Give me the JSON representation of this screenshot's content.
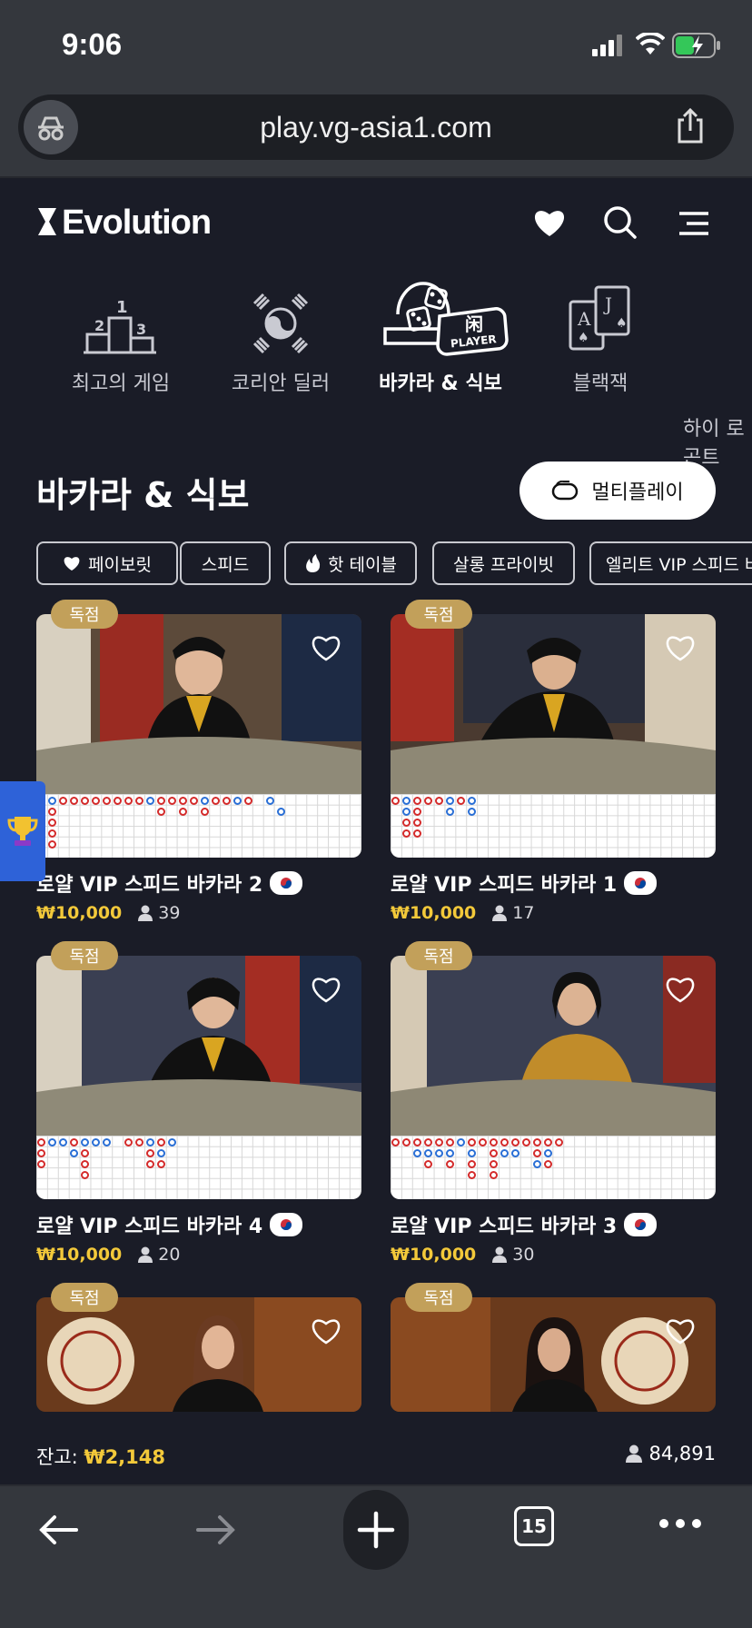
{
  "status": {
    "time": "9:06"
  },
  "browser": {
    "url": "play.vg-asia1.com",
    "tab_count": "15"
  },
  "header": {
    "logo": "Evolution"
  },
  "categories": [
    {
      "label": "최고의 게임"
    },
    {
      "label": "코리안 딜러"
    },
    {
      "label": "바카라 & 식보"
    },
    {
      "label": "블랙잭"
    },
    {
      "label": "하이 로\n곤트"
    }
  ],
  "icon_text": {
    "player": "PLAYER",
    "tile_char": "闲",
    "rank1": "1",
    "rank2": "2",
    "rank3": "3",
    "card_a": "A",
    "card_j": "J"
  },
  "section": {
    "title": "바카라 & 식보",
    "multiplay": "멀티플레이"
  },
  "filters": [
    {
      "label": "페이보릿"
    },
    {
      "label": "스피드"
    },
    {
      "label": "핫 테이블"
    },
    {
      "label": "살롱 프라이빗"
    },
    {
      "label": "엘리트 VIP 스피드 바"
    }
  ],
  "games": [
    {
      "badge": "독점",
      "name": "로얄 VIP 스피드 바카라 2",
      "price": "₩10,000",
      "players": "39"
    },
    {
      "badge": "독점",
      "name": "로얄 VIP 스피드 바카라 1",
      "price": "₩10,000",
      "players": "17"
    },
    {
      "badge": "독점",
      "name": "로얄 VIP 스피드 바카라 4",
      "price": "₩10,000",
      "players": "20"
    },
    {
      "badge": "독점",
      "name": "로얄 VIP 스피드 바카라 3",
      "price": "₩10,000",
      "players": "30"
    },
    {
      "badge": "독점"
    },
    {
      "badge": "독점"
    }
  ],
  "footer": {
    "balance_label": "잔고:",
    "balance_value": "₩2,148",
    "online_players": "84,891"
  },
  "colors": {
    "accent_gold": "#c2a05a",
    "price_yellow": "#f3c93a",
    "background": "#1a1c27"
  }
}
